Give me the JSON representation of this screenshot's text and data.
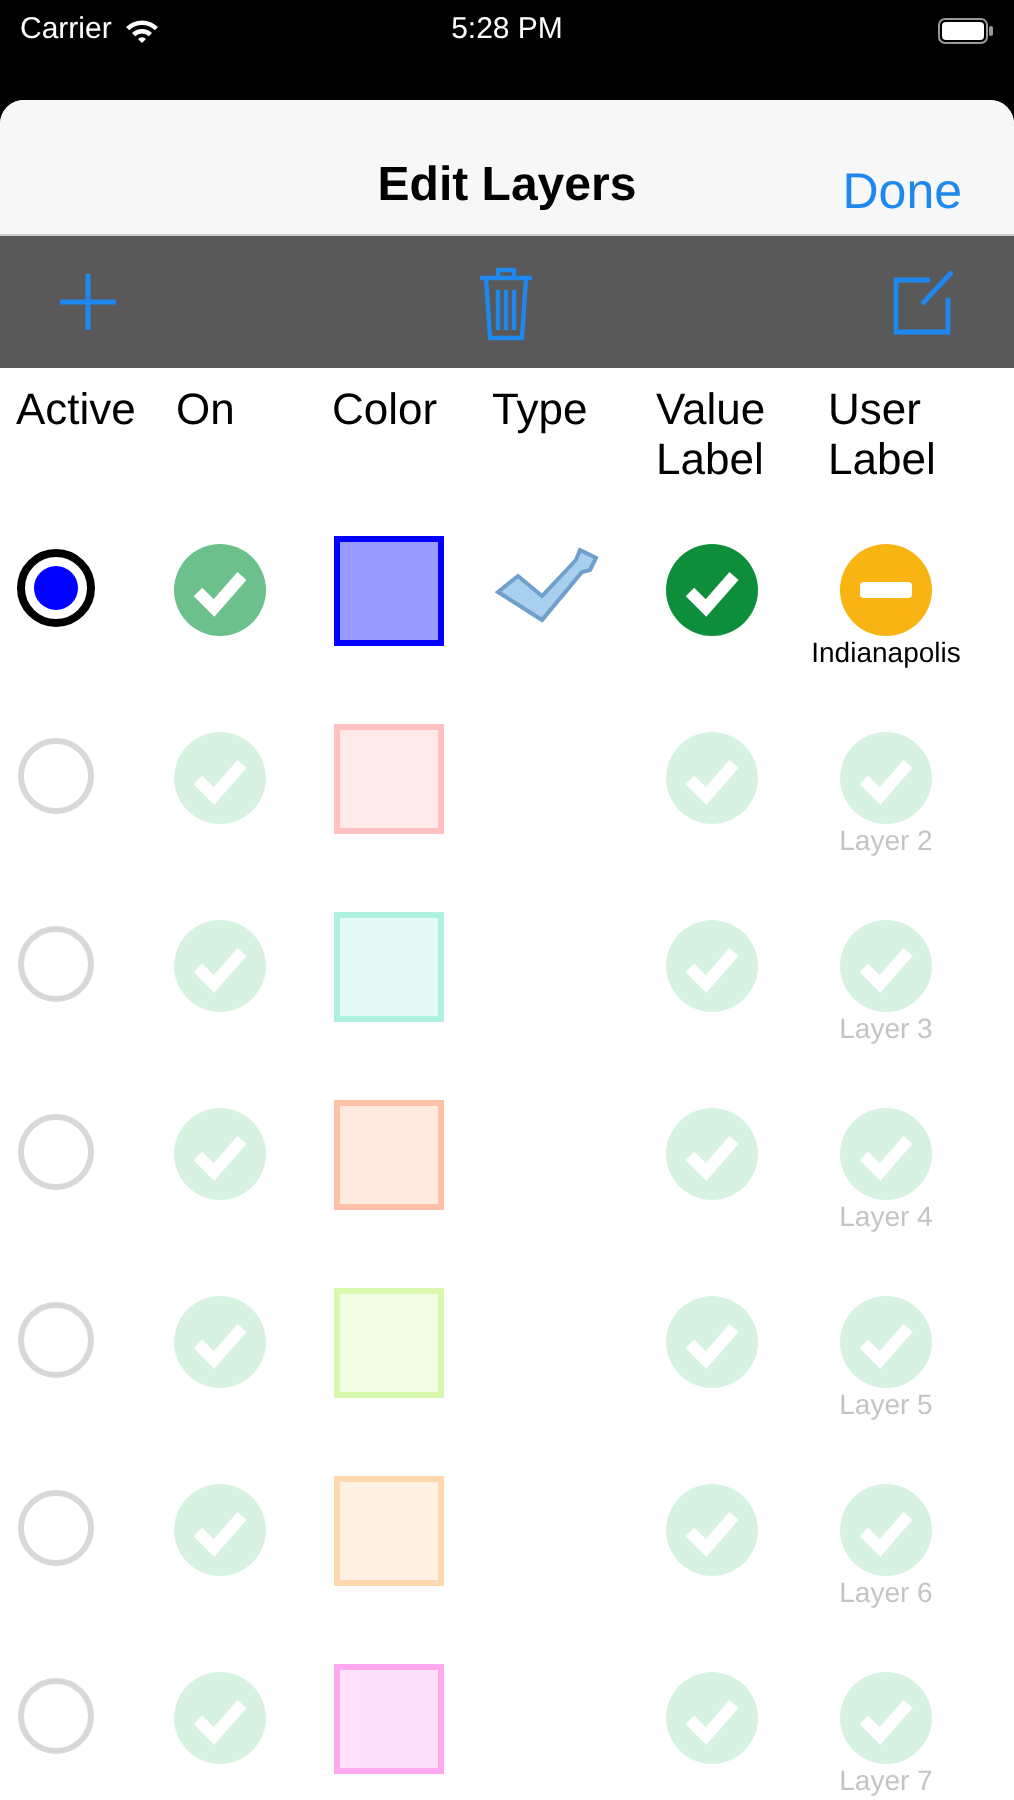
{
  "status_bar": {
    "carrier": "Carrier",
    "time": "5:28 PM"
  },
  "nav": {
    "title": "Edit Layers",
    "done": "Done"
  },
  "columns": [
    {
      "label": "Active"
    },
    {
      "label": "On"
    },
    {
      "label": "Color"
    },
    {
      "label": "Type"
    },
    {
      "label": "Value Label"
    },
    {
      "label": "User Label"
    }
  ],
  "layers": [
    {
      "selected": true,
      "dimmed": false,
      "color": "#0000ff",
      "type_icon": true,
      "user_label": {
        "kind": "minus",
        "text": "Indianapolis"
      }
    },
    {
      "selected": false,
      "dimmed": true,
      "color": "#ffc0c0",
      "type_icon": false,
      "user_label": {
        "kind": "check",
        "text": "Layer 2"
      }
    },
    {
      "selected": false,
      "dimmed": true,
      "color": "#b0f0e0",
      "type_icon": false,
      "user_label": {
        "kind": "check",
        "text": "Layer 3"
      }
    },
    {
      "selected": false,
      "dimmed": true,
      "color": "#ffc0a8",
      "type_icon": false,
      "user_label": {
        "kind": "check",
        "text": "Layer 4"
      }
    },
    {
      "selected": false,
      "dimmed": true,
      "color": "#d8f8b0",
      "type_icon": false,
      "user_label": {
        "kind": "check",
        "text": "Layer 5"
      }
    },
    {
      "selected": false,
      "dimmed": true,
      "color": "#ffd8b0",
      "type_icon": false,
      "user_label": {
        "kind": "check",
        "text": "Layer 6"
      }
    },
    {
      "selected": false,
      "dimmed": true,
      "color": "#ffa8f0",
      "type_icon": false,
      "user_label": {
        "kind": "check",
        "text": "Layer 7"
      }
    }
  ]
}
